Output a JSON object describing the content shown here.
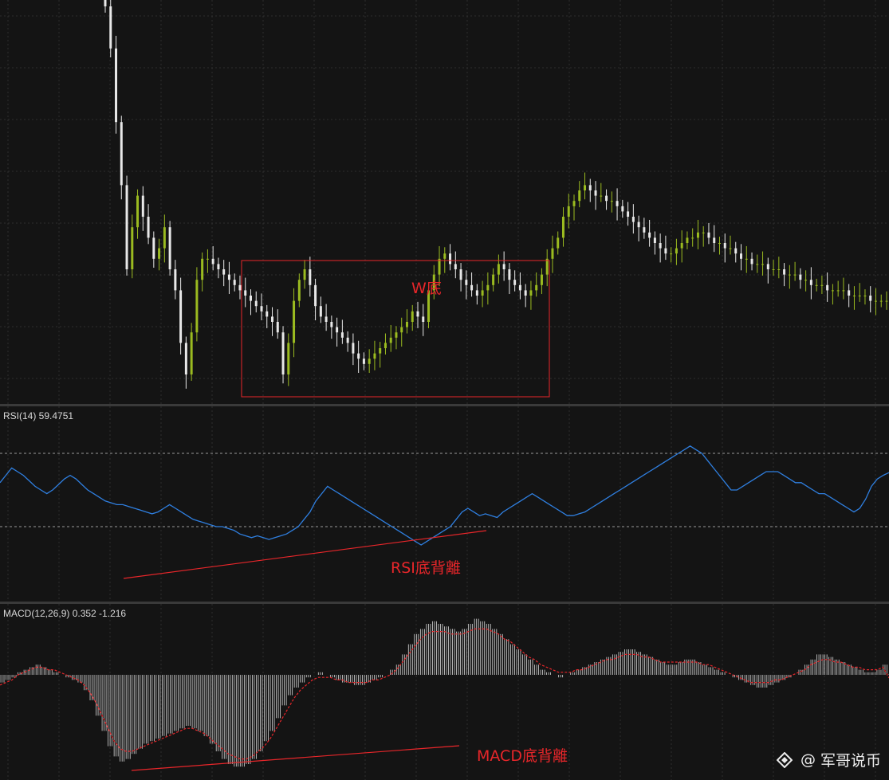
{
  "colors": {
    "background": "#141414",
    "grid": "#2e2e2e",
    "bull_candle": "#9bbb20",
    "bear_candle": "#e8e8e8",
    "rsi_line": "#2f7fe0",
    "macd_histogram": "#d8d8d8",
    "macd_signal": "#e8262a",
    "annotation": "#e8262a"
  },
  "annotations": {
    "w_bottom": "W底",
    "rsi_divergence": "RSI底背離",
    "macd_divergence": "MACD底背離"
  },
  "watermark": {
    "at": "@",
    "text": "军哥说币",
    "logo_icon": "diamond-logo-icon"
  },
  "chart_data": [
    {
      "type": "candlestick",
      "title": "",
      "xlabel": "",
      "ylabel": "",
      "grid": true,
      "legend": "none",
      "close": [
        100,
        92,
        78,
        66,
        50,
        58,
        64,
        60,
        56,
        52,
        54,
        58,
        50,
        46,
        36,
        30,
        38,
        48,
        52,
        52,
        51,
        50,
        49,
        48,
        47,
        46,
        45,
        44,
        43,
        42,
        41,
        40,
        38,
        30,
        36,
        44,
        48,
        50,
        47,
        43,
        41,
        40,
        39,
        38,
        37,
        36,
        34,
        33,
        32,
        33,
        34,
        35,
        36,
        37,
        38,
        39,
        40,
        42,
        41,
        40,
        46,
        49,
        52,
        53,
        51,
        50,
        48,
        47,
        46,
        45,
        46,
        47,
        49,
        51,
        50,
        48,
        47,
        46,
        45,
        46,
        47,
        49,
        52,
        54,
        56,
        60,
        62,
        63,
        65,
        66,
        65,
        64,
        64,
        63,
        63,
        62,
        61,
        60,
        59,
        58,
        57,
        56,
        55,
        54,
        53,
        53,
        54,
        55,
        56,
        56,
        57,
        57,
        56,
        55,
        55,
        54,
        54,
        53,
        52,
        52,
        51,
        51,
        51,
        50,
        50,
        50,
        49,
        49,
        49,
        48,
        48,
        47,
        47,
        47,
        46,
        46,
        46,
        46,
        45,
        45,
        45,
        45,
        44,
        44,
        44,
        44
      ]
    },
    {
      "type": "line",
      "title": "",
      "label": "RSI(14) 59.4751",
      "levels": [
        70,
        30
      ],
      "ylim": [
        0,
        100
      ],
      "values": [
        54,
        58,
        62,
        60,
        58,
        55,
        52,
        50,
        48,
        50,
        53,
        56,
        58,
        56,
        53,
        50,
        48,
        46,
        44,
        43,
        42,
        42,
        41,
        40,
        39,
        38,
        37,
        38,
        40,
        42,
        40,
        38,
        36,
        34,
        33,
        32,
        31,
        30,
        30,
        29,
        28,
        26,
        25,
        24,
        25,
        24,
        23,
        24,
        25,
        26,
        28,
        30,
        34,
        38,
        44,
        48,
        52,
        50,
        48,
        46,
        44,
        42,
        40,
        38,
        36,
        34,
        32,
        30,
        28,
        26,
        24,
        22,
        20,
        22,
        24,
        26,
        28,
        30,
        34,
        38,
        40,
        38,
        36,
        37,
        36,
        35,
        38,
        40,
        42,
        44,
        46,
        48,
        46,
        44,
        42,
        40,
        38,
        36,
        36,
        37,
        38,
        40,
        42,
        44,
        46,
        48,
        50,
        52,
        54,
        56,
        58,
        60,
        62,
        64,
        66,
        68,
        70,
        72,
        74,
        72,
        70,
        66,
        62,
        58,
        54,
        50,
        50,
        52,
        54,
        56,
        58,
        60,
        60,
        60,
        58,
        56,
        54,
        54,
        52,
        50,
        48,
        48,
        46,
        44,
        42,
        40,
        38,
        40,
        45,
        52,
        56,
        58,
        59.4751
      ]
    },
    {
      "type": "bar",
      "title": "",
      "label": "MACD(12,26,9) 0.352 -1.216",
      "series": [
        {
          "name": "MACD",
          "values": [
            -3,
            -2,
            -1,
            1,
            2,
            3,
            4,
            3,
            2,
            1,
            0,
            -1,
            -2,
            -3,
            -6,
            -10,
            -16,
            -22,
            -28,
            -32,
            -34,
            -33,
            -31,
            -29,
            -27,
            -26,
            -25,
            -24,
            -23,
            -22,
            -21,
            -20,
            -21,
            -22,
            -24,
            -27,
            -30,
            -33,
            -35,
            -36,
            -36,
            -35,
            -33,
            -30,
            -26,
            -22,
            -17,
            -12,
            -8,
            -5,
            -3,
            -1,
            0,
            1,
            0,
            -1,
            -2,
            -3,
            -3,
            -4,
            -4,
            -3,
            -2,
            -1,
            0,
            2,
            4,
            8,
            12,
            16,
            18,
            20,
            21,
            20,
            19,
            18,
            17,
            18,
            20,
            22,
            21,
            20,
            18,
            16,
            14,
            12,
            10,
            8,
            6,
            4,
            2,
            1,
            0,
            -1,
            0,
            1,
            2,
            3,
            4,
            5,
            6,
            7,
            8,
            9,
            10,
            10,
            9,
            8,
            7,
            6,
            5,
            4,
            4,
            5,
            6,
            6,
            5,
            4,
            3,
            2,
            1,
            0,
            -1,
            -2,
            -3,
            -4,
            -5,
            -5,
            -4,
            -3,
            -2,
            -1,
            0,
            2,
            4,
            6,
            8,
            8,
            7,
            6,
            5,
            4,
            3,
            2,
            1,
            1,
            2,
            4,
            0.352
          ]
        },
        {
          "name": "Signal",
          "values": [
            -4,
            -3,
            -2,
            0,
            1,
            2,
            3,
            3,
            2,
            2,
            1,
            0,
            -1,
            -2,
            -4,
            -7,
            -11,
            -16,
            -21,
            -26,
            -29,
            -30,
            -30,
            -29,
            -28,
            -27,
            -26,
            -25,
            -24,
            -23,
            -22,
            -21,
            -21,
            -22,
            -23,
            -25,
            -27,
            -29,
            -31,
            -32,
            -33,
            -33,
            -32,
            -30,
            -28,
            -25,
            -21,
            -17,
            -13,
            -9,
            -6,
            -4,
            -2,
            -1,
            -1,
            -1,
            -2,
            -2,
            -3,
            -3,
            -3,
            -3,
            -2,
            -2,
            -1,
            0,
            2,
            5,
            8,
            11,
            14,
            16,
            17,
            17,
            17,
            16,
            16,
            16,
            17,
            18,
            18,
            18,
            17,
            16,
            14,
            13,
            11,
            9,
            7,
            6,
            4,
            3,
            2,
            1,
            1,
            1,
            2,
            2,
            3,
            4,
            5,
            6,
            6,
            7,
            8,
            8,
            8,
            7,
            7,
            6,
            5,
            5,
            5,
            5,
            5,
            5,
            5,
            4,
            4,
            3,
            2,
            1,
            0,
            -1,
            -2,
            -3,
            -3,
            -3,
            -3,
            -2,
            -2,
            -1,
            0,
            1,
            2,
            4,
            5,
            6,
            6,
            5,
            5,
            4,
            3,
            3,
            2,
            2,
            2,
            3,
            -1.216
          ]
        }
      ]
    }
  ]
}
